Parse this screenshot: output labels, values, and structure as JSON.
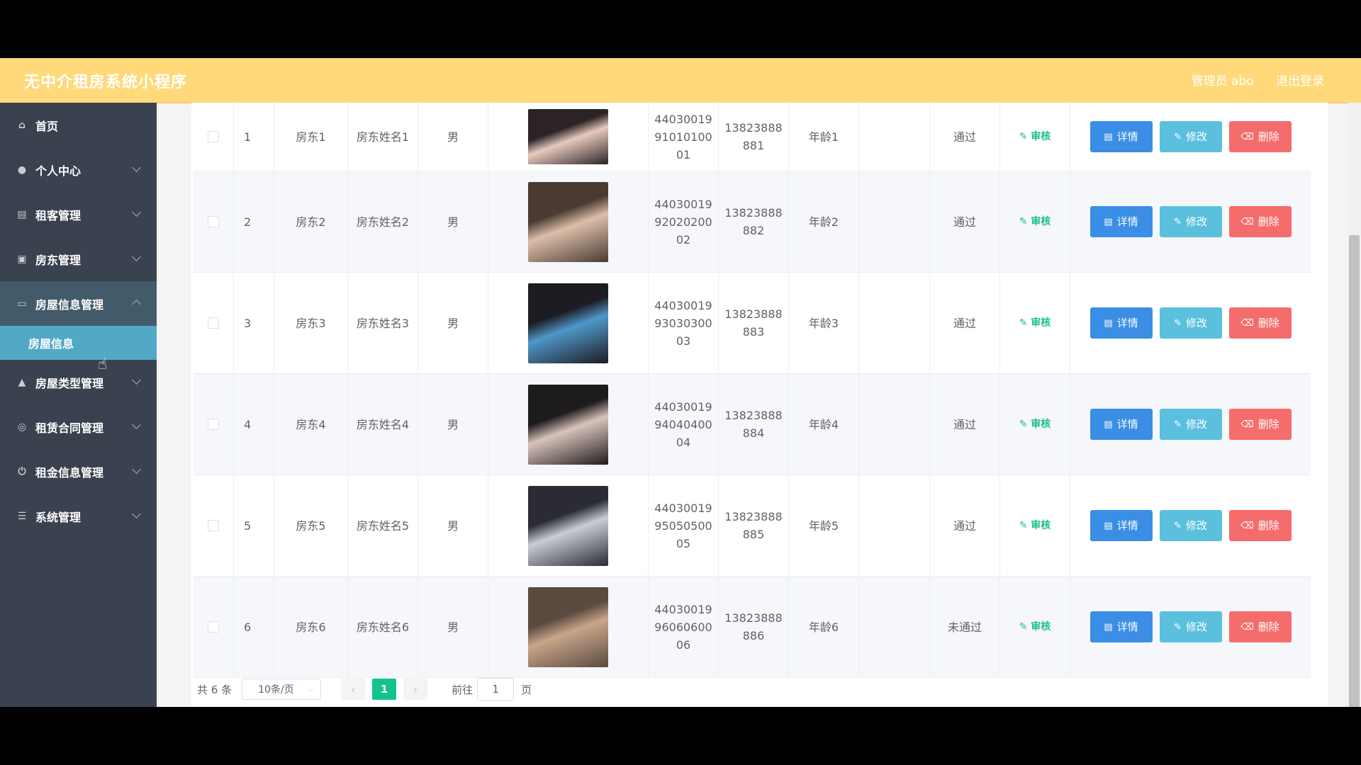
{
  "header": {
    "brand": "无中介租房系统小程序",
    "admin": "管理员 abo",
    "logout": "退出登录"
  },
  "sidebar": {
    "items": [
      {
        "label": "首页",
        "icon": "home-icon",
        "has_children": false
      },
      {
        "label": "个人中心",
        "icon": "user-icon",
        "has_children": true
      },
      {
        "label": "租客管理",
        "icon": "list-icon",
        "has_children": true
      },
      {
        "label": "房东管理",
        "icon": "clipboard-icon",
        "has_children": true
      },
      {
        "label": "房屋信息管理",
        "icon": "card-icon",
        "has_children": true,
        "open": true
      },
      {
        "label": "房屋类型管理",
        "icon": "user-tie-icon",
        "has_children": true
      },
      {
        "label": "租赁合同管理",
        "icon": "globe-icon",
        "has_children": true
      },
      {
        "label": "租金信息管理",
        "icon": "power-icon",
        "has_children": true
      },
      {
        "label": "系统管理",
        "icon": "menu-icon",
        "has_children": true
      }
    ],
    "sub_item": "房屋信息"
  },
  "table": {
    "rows": [
      {
        "index": "1",
        "account": "房东1",
        "name": "房东姓名1",
        "gender": "男",
        "id_lines": [
          "44030019",
          "91010100",
          "01"
        ],
        "phone_lines": [
          "13823888",
          "881"
        ],
        "age": "年龄1",
        "status": "通过",
        "avatar_colors": [
          "#2b2326",
          "#e7c9be"
        ]
      },
      {
        "index": "2",
        "account": "房东2",
        "name": "房东姓名2",
        "gender": "男",
        "id_lines": [
          "44030019",
          "92020200",
          "02"
        ],
        "phone_lines": [
          "13823888",
          "882"
        ],
        "age": "年龄2",
        "status": "通过",
        "avatar_colors": [
          "#4a3a32",
          "#dcbfa9"
        ]
      },
      {
        "index": "3",
        "account": "房东3",
        "name": "房东姓名3",
        "gender": "男",
        "id_lines": [
          "44030019",
          "93030300",
          "03"
        ],
        "phone_lines": [
          "13823888",
          "883"
        ],
        "age": "年龄3",
        "status": "通过",
        "avatar_colors": [
          "#1c1c22",
          "#4f97c9"
        ]
      },
      {
        "index": "4",
        "account": "房东4",
        "name": "房东姓名4",
        "gender": "男",
        "id_lines": [
          "44030019",
          "94040400",
          "04"
        ],
        "phone_lines": [
          "13823888",
          "884"
        ],
        "age": "年龄4",
        "status": "通过",
        "avatar_colors": [
          "#1e1b1d",
          "#d9c4bb"
        ]
      },
      {
        "index": "5",
        "account": "房东5",
        "name": "房东姓名5",
        "gender": "男",
        "id_lines": [
          "44030019",
          "95050500",
          "05"
        ],
        "phone_lines": [
          "13823888",
          "885"
        ],
        "age": "年龄5",
        "status": "通过",
        "avatar_colors": [
          "#2a2b33",
          "#c8cdd6"
        ]
      },
      {
        "index": "6",
        "account": "房东6",
        "name": "房东姓名6",
        "gender": "男",
        "id_lines": [
          "44030019",
          "96060600",
          "06"
        ],
        "phone_lines": [
          "13823888",
          "886"
        ],
        "age": "年龄6",
        "status": "未通过",
        "avatar_colors": [
          "#5a4a40",
          "#c9a58a"
        ]
      }
    ],
    "audit_label": "审核",
    "detail_label": "详情",
    "edit_label": "修改",
    "delete_label": "删除"
  },
  "pagination": {
    "total": "共 6 条",
    "page_size": "10条/页",
    "current_page": "1",
    "goto_prefix": "前往",
    "goto_value": "1",
    "goto_suffix": "页"
  },
  "colors": {
    "topbar": "#ffd97a",
    "sidebar": "#3a4250",
    "sub_active": "#52a8c7",
    "detail": "#3a8ee6",
    "edit": "#5bc0de",
    "delete": "#f56c6c",
    "pager_active": "#13c28d"
  }
}
